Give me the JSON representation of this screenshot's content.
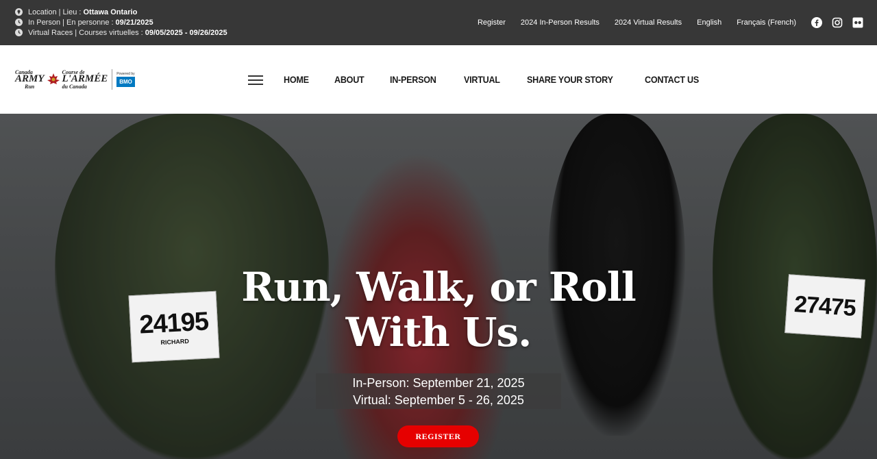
{
  "info": {
    "location_label": "Location | Lieu :",
    "location_value": "Ottawa Ontario",
    "inperson_label": "In Person | En personne :",
    "inperson_value": "09/21/2025",
    "virtual_label": "Virtual Races | Courses virtuelles :",
    "virtual_value": "09/05/2025 - 09/26/2025"
  },
  "toplinks": [
    "Register",
    "2024 In-Person Results",
    "2024 Virtual Results",
    "English",
    "Français (French)"
  ],
  "social": [
    "facebook-icon",
    "instagram-icon",
    "flickr-icon"
  ],
  "logo": {
    "army_small": "Canada",
    "army_big": "ARMY",
    "army_run": "Run",
    "fr_small": "Course de",
    "fr_big": "L'ARMÉE",
    "fr_sub": "du Canada",
    "powered": "Powered by",
    "bmo": "BMO"
  },
  "nav": [
    "HOME",
    "ABOUT",
    "IN-PERSON",
    "VIRTUAL",
    "SHARE YOUR STORY",
    "CONTACT US"
  ],
  "hero": {
    "title_line1": "Run, Walk, or Roll",
    "title_line2": "With Us.",
    "date_inperson": "In-Person: September 21, 2025",
    "date_virtual": "Virtual: September 5 - 26, 2025",
    "register": "REGISTER",
    "bib1": "24195",
    "bib1_name": "RICHARD",
    "bib2": "27475"
  },
  "colors": {
    "topbar": "#373737",
    "accent": "#e60000",
    "bmo_blue": "#0079c1"
  }
}
